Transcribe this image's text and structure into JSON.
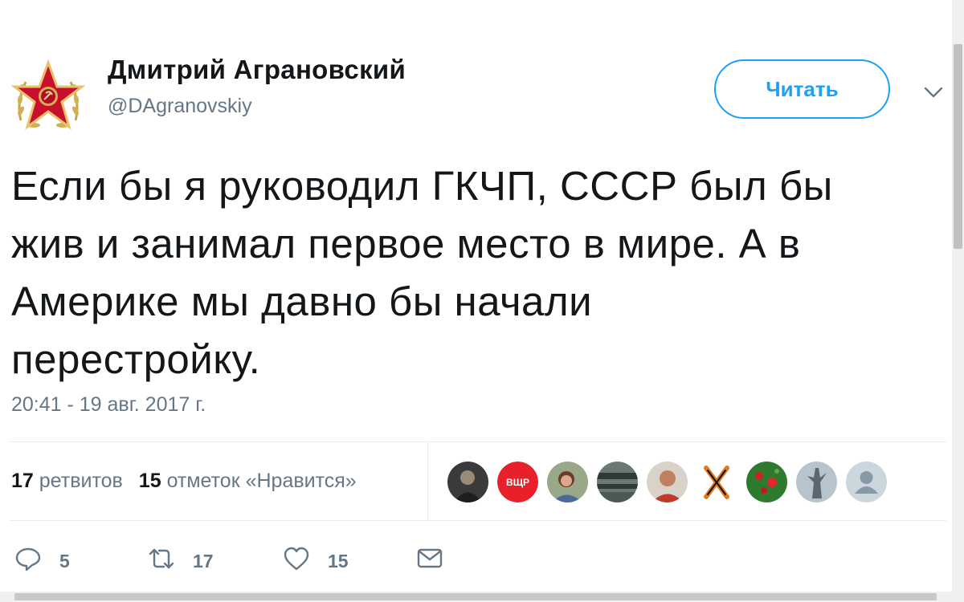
{
  "author": {
    "name": "Дмитрий Аграновский",
    "handle": "@DAgranovskiy"
  },
  "follow_button": {
    "label": "Читать"
  },
  "tweet": {
    "lines": [
      "Если бы я руководил ГКЧП, СССР был бы",
      "жив и занимал первое место в мире. А в",
      "Америке мы давно бы начали",
      "перестройку."
    ],
    "timestamp": "20:41 - 19 авг. 2017 г."
  },
  "stats": {
    "retweets_count": "17",
    "retweets_label": "ретвитов",
    "likes_count": "15",
    "likes_label": "отметок «Нравится»"
  },
  "liker_avatars": [
    {
      "icon": "photo-avatar",
      "color": "#3a3a3a"
    },
    {
      "icon": "text-avatar",
      "text": "ВЩР",
      "color": "#e8202a"
    },
    {
      "icon": "photo-avatar",
      "color": "#7a8a6a"
    },
    {
      "icon": "photo-avatar",
      "color": "#4c5a55"
    },
    {
      "icon": "photo-avatar",
      "color": "#b5654a"
    },
    {
      "icon": "ribbon-avatar",
      "color": "#e07a1c"
    },
    {
      "icon": "photo-avatar",
      "color": "#2f8a2f"
    },
    {
      "icon": "photo-avatar",
      "color": "#8c9aa8"
    },
    {
      "icon": "default-avatar",
      "color": "#ccd6dd"
    }
  ],
  "actions": {
    "reply_count": "5",
    "retweet_count": "17",
    "like_count": "15"
  },
  "colors": {
    "accent": "#1da1f2",
    "secondary_text": "#657786",
    "primary_text": "#14171a"
  }
}
